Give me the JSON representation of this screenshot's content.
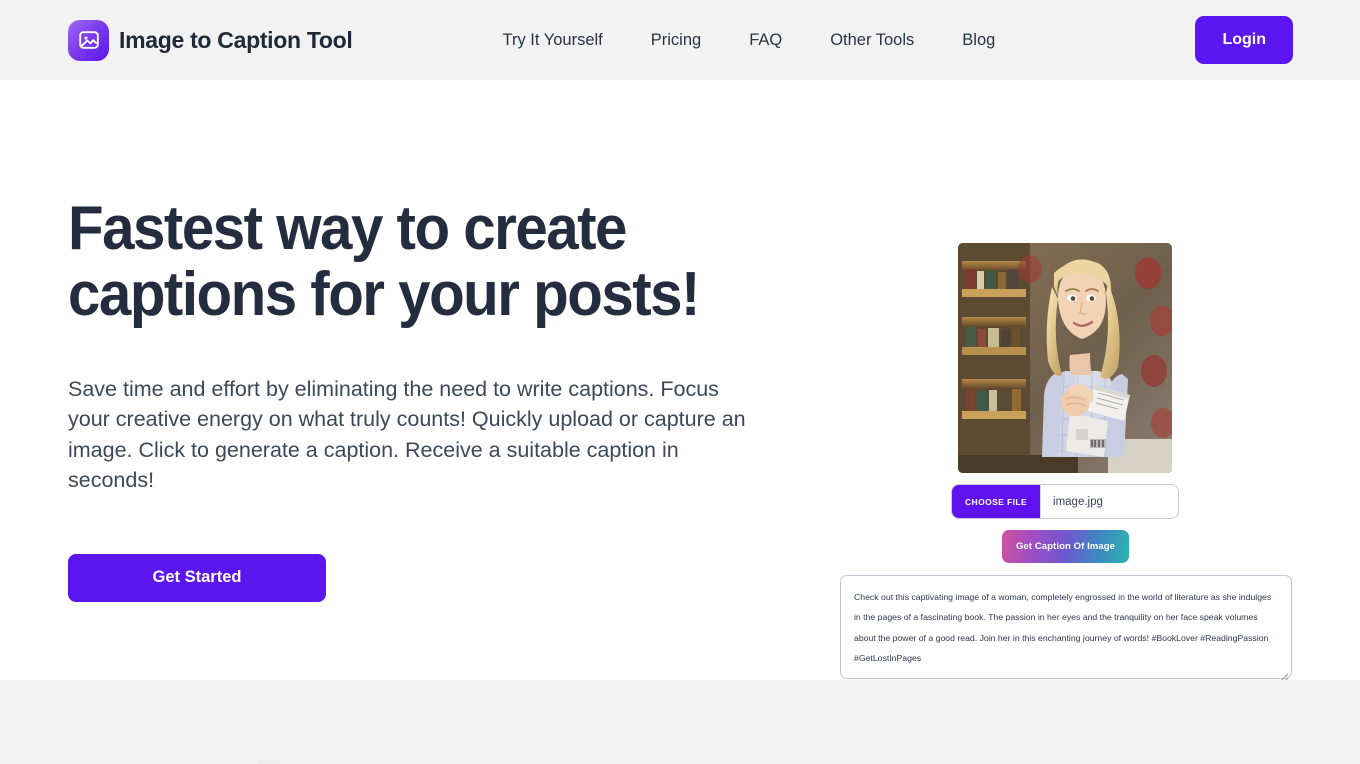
{
  "header": {
    "brand_name": "Image to Caption Tool",
    "logo_icon": "image-photo-icon",
    "nav": [
      {
        "label": "Try It Yourself"
      },
      {
        "label": "Pricing"
      },
      {
        "label": "FAQ"
      },
      {
        "label": "Other Tools"
      },
      {
        "label": "Blog"
      }
    ],
    "login_label": "Login",
    "accent_color": "#5b15ef",
    "background_color": "#f2f2f3"
  },
  "hero": {
    "title": "Fastest way to create captions for your posts!",
    "subtitle": "Save time and effort by eliminating the need to write captions. Focus your creative energy on what truly counts! Quickly upload or capture an image. Click to generate a caption. Receive a suitable caption in seconds!",
    "cta_label": "Get Started",
    "title_color": "#232d3f"
  },
  "demo": {
    "photo_alt": "Blonde woman in a plaid shirt holding a book in a bookstore",
    "choose_file_label": "CHOOSE FILE",
    "file_name": "image.jpg",
    "get_caption_label": "Get Caption Of Image",
    "caption_text": "Check out this captivating image of a woman, completely engrossed in the world of literature as she indulges in the pages of a fascinating book. The passion in her eyes and the tranquility on her face speak volumes about the power of a good read. Join her in this enchanting journey of words! #BookLover #ReadingPassion #GetLostInPages",
    "gradient_start": "#d0529f",
    "gradient_end": "#2ab5ad"
  }
}
